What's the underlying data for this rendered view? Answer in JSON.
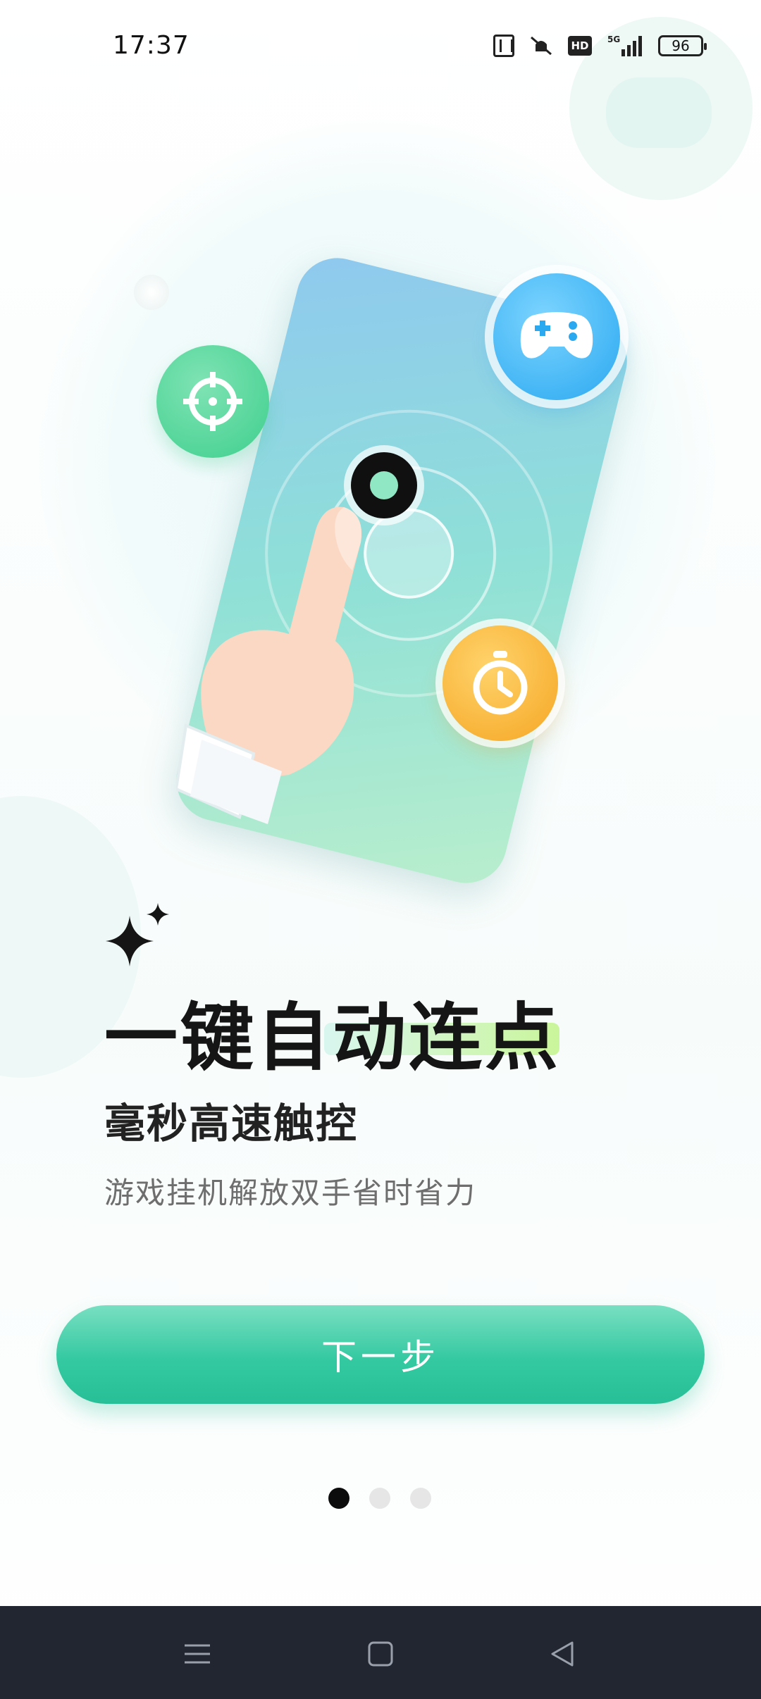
{
  "status_bar": {
    "time": "17:37",
    "battery_level": "96",
    "icons": [
      "nfc-icon",
      "mute-vibrate-icon",
      "hd-icon",
      "5g-signal-icon",
      "battery-icon"
    ]
  },
  "onboarding": {
    "title": "一键自动连点",
    "subtitle": "毫秒高速触控",
    "description": "游戏挂机解放双手省时省力"
  },
  "next_button": {
    "label": "下一步"
  },
  "pager": {
    "total": 3,
    "current": 1
  },
  "illustration": {
    "icons": [
      "crosshair-icon",
      "gamepad-icon",
      "stopwatch-icon",
      "finger-tap-icon"
    ]
  },
  "colors": {
    "accent": "#2fc69e",
    "title_highlight": "#b8f08f",
    "nav_bar": "#222630"
  },
  "nav_bar": {
    "icons": [
      "menu-icon",
      "home-icon",
      "back-icon"
    ]
  }
}
